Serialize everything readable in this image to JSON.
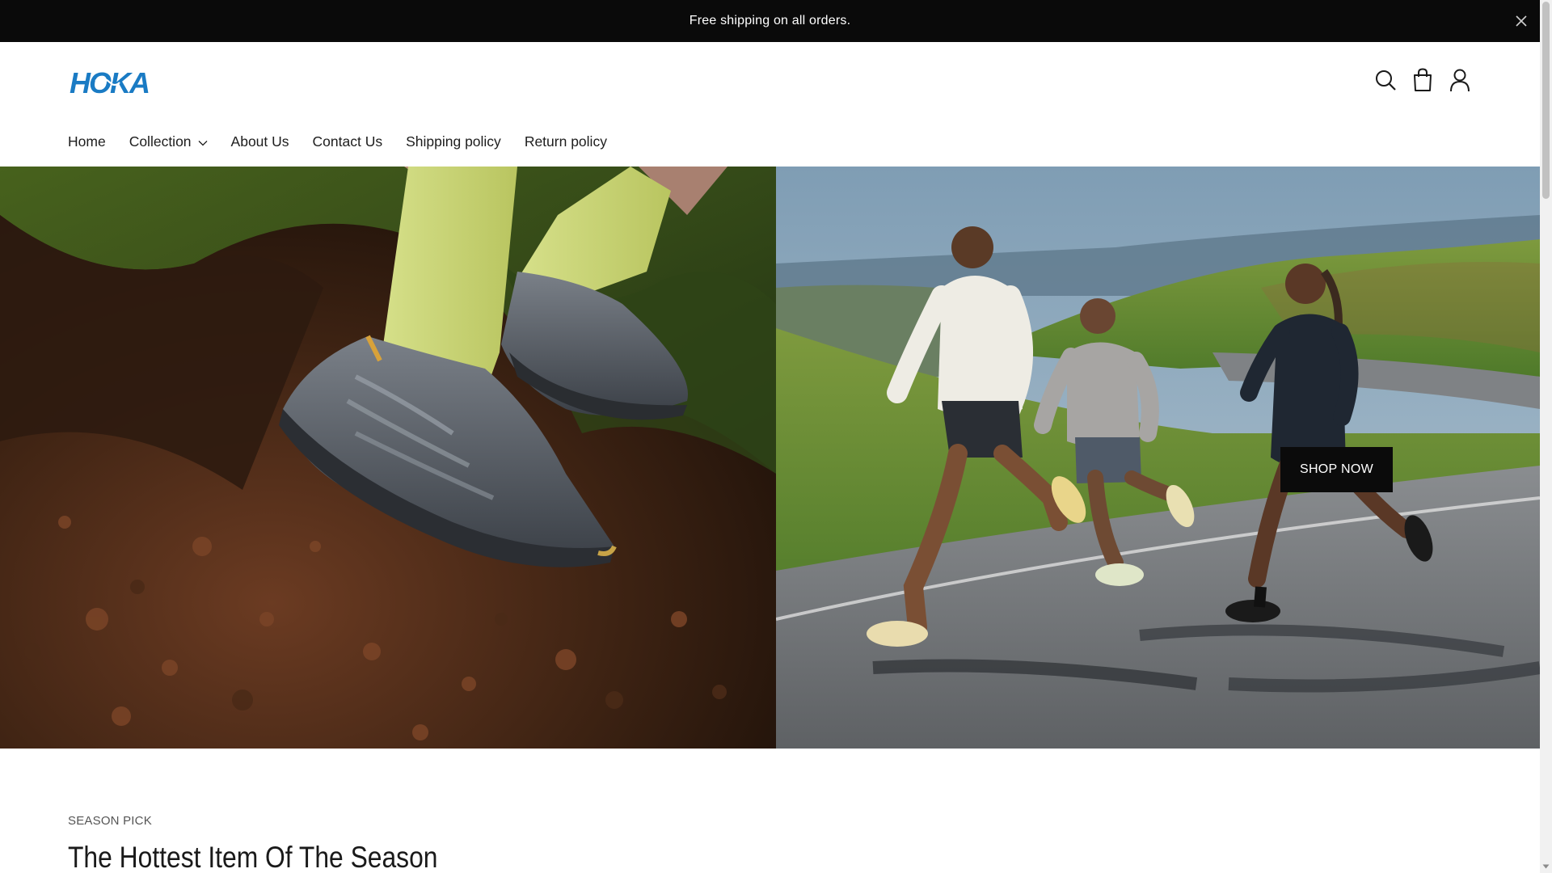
{
  "announcement": {
    "text": "Free shipping on all orders.",
    "close_icon": "close-icon"
  },
  "header": {
    "logo_text": "HOKA",
    "brand_color": "#1a7bc4",
    "icons": [
      "search-icon",
      "cart-icon",
      "account-icon"
    ]
  },
  "nav": {
    "items": [
      {
        "label": "Home"
      },
      {
        "label": "Collection",
        "has_dropdown": true
      },
      {
        "label": "About Us"
      },
      {
        "label": "Contact Us"
      },
      {
        "label": "Shipping policy"
      },
      {
        "label": "Return policy"
      }
    ]
  },
  "hero": {
    "cta_label": "SHOP NOW"
  },
  "section": {
    "eyebrow": "SEASON PICK",
    "title": "The Hottest Item Of The Season"
  }
}
